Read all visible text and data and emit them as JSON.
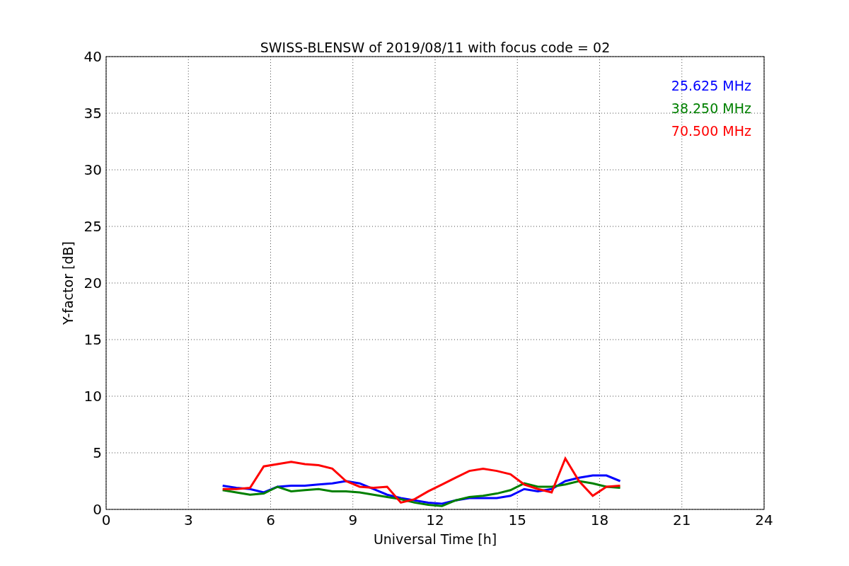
{
  "figure": {
    "chart_data": {
      "type": "line",
      "title": "SWISS-BLENSW of 2019/08/11 with focus code = 02",
      "xlabel": "Universal Time [h]",
      "ylabel": "Y-factor [dB]",
      "x": [
        4.25,
        4.75,
        5.25,
        5.75,
        6.25,
        6.75,
        7.25,
        7.75,
        8.25,
        8.75,
        9.25,
        9.75,
        10.25,
        10.75,
        11.25,
        11.75,
        12.25,
        12.75,
        13.25,
        13.75,
        14.25,
        14.75,
        15.25,
        15.75,
        16.25,
        16.75,
        17.25,
        17.75,
        18.25,
        18.75
      ],
      "series": [
        {
          "name": "25.625 MHz",
          "color": "#0000ff",
          "values": [
            2.1,
            1.9,
            1.8,
            1.5,
            2.0,
            2.1,
            2.1,
            2.2,
            2.3,
            2.5,
            2.3,
            1.8,
            1.3,
            1.0,
            0.8,
            0.6,
            0.5,
            0.8,
            1.0,
            1.0,
            1.0,
            1.2,
            1.8,
            1.6,
            1.8,
            2.5,
            2.8,
            3.0,
            3.0,
            2.5
          ]
        },
        {
          "name": "38.250 MHz",
          "color": "#008000",
          "values": [
            1.7,
            1.5,
            1.3,
            1.4,
            2.0,
            1.6,
            1.7,
            1.8,
            1.6,
            1.6,
            1.5,
            1.3,
            1.1,
            0.9,
            0.6,
            0.4,
            0.3,
            0.8,
            1.1,
            1.2,
            1.4,
            1.7,
            2.3,
            2.0,
            2.0,
            2.2,
            2.5,
            2.3,
            2.0,
            1.9
          ]
        },
        {
          "name": "70.500 MHz",
          "color": "#ff0000",
          "values": [
            1.8,
            1.8,
            1.9,
            3.8,
            4.0,
            4.2,
            4.0,
            3.9,
            3.6,
            2.5,
            2.0,
            1.9,
            2.0,
            0.6,
            0.9,
            1.6,
            2.2,
            2.8,
            3.4,
            3.6,
            3.4,
            3.1,
            2.2,
            1.8,
            1.5,
            4.5,
            2.5,
            1.2,
            2.0,
            2.1
          ]
        }
      ],
      "grid": true,
      "xlim": [
        0,
        24
      ],
      "ylim": [
        0,
        40
      ],
      "xticks": [
        0,
        3,
        6,
        9,
        12,
        15,
        18,
        21,
        24
      ],
      "yticks": [
        0,
        5,
        10,
        15,
        20,
        25,
        30,
        35,
        40
      ]
    }
  }
}
